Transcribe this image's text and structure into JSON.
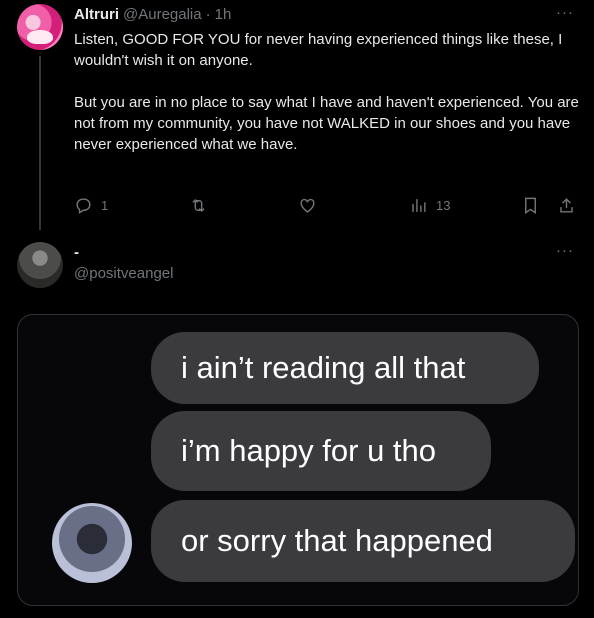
{
  "tweet": {
    "display_name": "Altruri",
    "handle": "@Auregalia",
    "separator": "·",
    "time": "1h",
    "more": "···",
    "paragraphs": [
      "Listen, GOOD FOR YOU for never having experienced things like these, I wouldn't wish it on anyone.",
      "But you are in no place to say what I have and haven't experienced. You are not from my community, you have not WALKED in our shoes and you have never experienced what we have."
    ],
    "actions": {
      "reply_count": "1",
      "retweet_count": "",
      "like_count": "",
      "view_count": "13"
    }
  },
  "reply": {
    "display_name": "-",
    "handle": "@positveangel",
    "more": "···",
    "media_bubbles": [
      "i ain’t reading all that",
      "i’m happy for u tho",
      "or sorry that happened"
    ]
  },
  "icons": [
    "reply-icon",
    "retweet-icon",
    "like-icon",
    "views-icon",
    "bookmark-icon",
    "share-icon",
    "more-icon"
  ],
  "colors": {
    "background": "#000000",
    "text": "#e7e9ea",
    "muted": "#71767b",
    "bubble": "#3b3b3f"
  }
}
